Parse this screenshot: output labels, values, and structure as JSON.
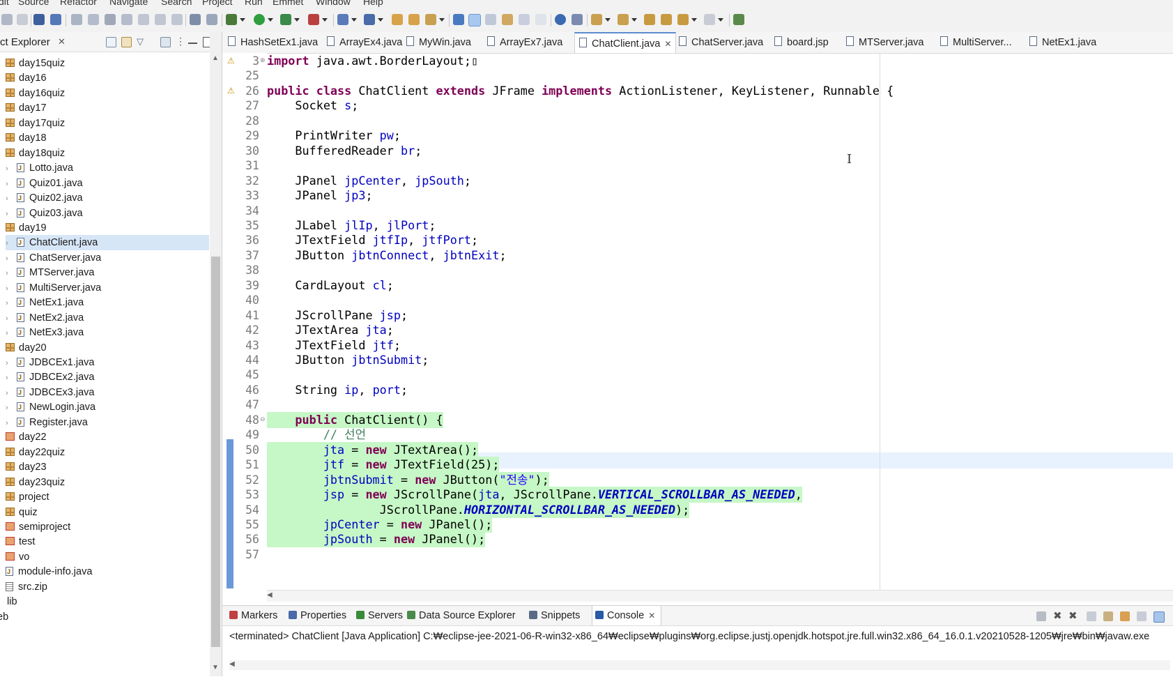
{
  "menu": [
    "dit",
    "Source",
    "Refactor",
    "Navigate",
    "Search",
    "Project",
    "Run",
    "Emmet",
    "Window",
    "Help"
  ],
  "explorer": {
    "title": "ct Explorer",
    "close_glyph": "✕",
    "tree": [
      {
        "label": "day15quiz",
        "kind": "package",
        "indent": 0
      },
      {
        "label": "day16",
        "kind": "package",
        "indent": 0
      },
      {
        "label": "day16quiz",
        "kind": "package",
        "indent": 0
      },
      {
        "label": "day17",
        "kind": "package",
        "indent": 0
      },
      {
        "label": "day17quiz",
        "kind": "package",
        "indent": 0
      },
      {
        "label": "day18",
        "kind": "package",
        "indent": 0
      },
      {
        "label": "day18quiz",
        "kind": "package",
        "indent": 0
      },
      {
        "label": "Lotto.java",
        "kind": "java",
        "indent": 1
      },
      {
        "label": "Quiz01.java",
        "kind": "java",
        "indent": 1
      },
      {
        "label": "Quiz02.java",
        "kind": "java",
        "indent": 1
      },
      {
        "label": "Quiz03.java",
        "kind": "java",
        "indent": 1
      },
      {
        "label": "day19",
        "kind": "package",
        "indent": 0
      },
      {
        "label": "ChatClient.java",
        "kind": "java",
        "indent": 1,
        "selected": true
      },
      {
        "label": "ChatServer.java",
        "kind": "java",
        "indent": 1
      },
      {
        "label": "MTServer.java",
        "kind": "java",
        "indent": 1
      },
      {
        "label": "MultiServer.java",
        "kind": "java",
        "indent": 1
      },
      {
        "label": "NetEx1.java",
        "kind": "java",
        "indent": 1
      },
      {
        "label": "NetEx2.java",
        "kind": "java",
        "indent": 1
      },
      {
        "label": "NetEx3.java",
        "kind": "java",
        "indent": 1
      },
      {
        "label": "day20",
        "kind": "package",
        "indent": 0
      },
      {
        "label": "JDBCEx1.java",
        "kind": "java",
        "indent": 1
      },
      {
        "label": "JDBCEx2.java",
        "kind": "java",
        "indent": 1
      },
      {
        "label": "JDBCEx3.java",
        "kind": "java",
        "indent": 1
      },
      {
        "label": "NewLogin.java",
        "kind": "java",
        "indent": 1
      },
      {
        "label": "Register.java",
        "kind": "java",
        "indent": 1
      },
      {
        "label": "day22",
        "kind": "package-error",
        "indent": 0
      },
      {
        "label": "day22quiz",
        "kind": "package",
        "indent": 0
      },
      {
        "label": "day23",
        "kind": "package",
        "indent": 0
      },
      {
        "label": "day23quiz",
        "kind": "package",
        "indent": 0
      },
      {
        "label": "project",
        "kind": "package",
        "indent": 0
      },
      {
        "label": "quiz",
        "kind": "package",
        "indent": 0
      },
      {
        "label": "semiproject",
        "kind": "package-error",
        "indent": 0
      },
      {
        "label": "test",
        "kind": "package-error",
        "indent": 0
      },
      {
        "label": "vo",
        "kind": "package-error",
        "indent": 0
      },
      {
        "label": "module-info.java",
        "kind": "java-plain",
        "indent": 0
      },
      {
        "label": "src.zip",
        "kind": "zip",
        "indent": 0
      },
      {
        "label": "lib",
        "kind": "folder-collapsed",
        "indent": -1
      },
      {
        "label": "eb",
        "kind": "folder-plain",
        "indent": -1
      }
    ]
  },
  "editor": {
    "tabs": [
      {
        "label": "HashSetEx1.java",
        "active": false
      },
      {
        "label": "ArrayEx4.java",
        "active": false
      },
      {
        "label": "MyWin.java",
        "active": false
      },
      {
        "label": "ArrayEx7.java",
        "active": false
      },
      {
        "label": "ChatClient.java",
        "active": true,
        "close": "✕"
      },
      {
        "label": "ChatServer.java",
        "active": false
      },
      {
        "label": "board.jsp",
        "active": false
      },
      {
        "label": "MTServer.java",
        "active": false
      },
      {
        "label": "MultiServer...",
        "active": false
      },
      {
        "label": "NetEx1.java",
        "active": false
      }
    ],
    "lines": [
      {
        "n": "3",
        "fold": "⊕",
        "warn": true,
        "tokens": [
          [
            "kw",
            "import"
          ],
          [
            "",
            " java.awt.BorderLayout;▯"
          ]
        ]
      },
      {
        "n": "25",
        "tokens": []
      },
      {
        "n": "26",
        "warn": true,
        "tokens": [
          [
            "kw",
            "public class"
          ],
          [
            "",
            " ChatClient "
          ],
          [
            "kw",
            "extends"
          ],
          [
            "",
            " JFrame "
          ],
          [
            "kw",
            "implements"
          ],
          [
            "",
            " ActionListener, KeyListener, Runnable {"
          ]
        ]
      },
      {
        "n": "27",
        "tokens": [
          [
            "",
            "    Socket "
          ],
          [
            "fld",
            "s"
          ],
          [
            "",
            ";"
          ]
        ]
      },
      {
        "n": "28",
        "tokens": []
      },
      {
        "n": "29",
        "tokens": [
          [
            "",
            "    PrintWriter "
          ],
          [
            "fld",
            "pw"
          ],
          [
            "",
            ";"
          ]
        ]
      },
      {
        "n": "30",
        "tokens": [
          [
            "",
            "    BufferedReader "
          ],
          [
            "fld",
            "br"
          ],
          [
            "",
            ";"
          ]
        ]
      },
      {
        "n": "31",
        "tokens": []
      },
      {
        "n": "32",
        "tokens": [
          [
            "",
            "    JPanel "
          ],
          [
            "fld",
            "jpCenter"
          ],
          [
            "",
            ", "
          ],
          [
            "fld",
            "jpSouth"
          ],
          [
            "",
            ";"
          ]
        ]
      },
      {
        "n": "33",
        "tokens": [
          [
            "",
            "    JPanel "
          ],
          [
            "fld",
            "jp3"
          ],
          [
            "",
            ";"
          ]
        ]
      },
      {
        "n": "34",
        "tokens": []
      },
      {
        "n": "35",
        "tokens": [
          [
            "",
            "    JLabel "
          ],
          [
            "fld",
            "jlIp"
          ],
          [
            "",
            ", "
          ],
          [
            "fld",
            "jlPort"
          ],
          [
            "",
            ";"
          ]
        ]
      },
      {
        "n": "36",
        "tokens": [
          [
            "",
            "    JTextField "
          ],
          [
            "fld",
            "jtfIp"
          ],
          [
            "",
            ", "
          ],
          [
            "fld",
            "jtfPort"
          ],
          [
            "",
            ";"
          ]
        ]
      },
      {
        "n": "37",
        "tokens": [
          [
            "",
            "    JButton "
          ],
          [
            "fld",
            "jbtnConnect"
          ],
          [
            "",
            ", "
          ],
          [
            "fld",
            "jbtnExit"
          ],
          [
            "",
            ";"
          ]
        ]
      },
      {
        "n": "38",
        "tokens": []
      },
      {
        "n": "39",
        "tokens": [
          [
            "",
            "    CardLayout "
          ],
          [
            "fld",
            "cl"
          ],
          [
            "",
            ";"
          ]
        ]
      },
      {
        "n": "40",
        "tokens": []
      },
      {
        "n": "41",
        "tokens": [
          [
            "",
            "    JScrollPane "
          ],
          [
            "fld",
            "jsp"
          ],
          [
            "",
            ";"
          ]
        ]
      },
      {
        "n": "42",
        "tokens": [
          [
            "",
            "    JTextArea "
          ],
          [
            "fld",
            "jta"
          ],
          [
            "",
            ";"
          ]
        ]
      },
      {
        "n": "43",
        "tokens": [
          [
            "",
            "    JTextField "
          ],
          [
            "fld",
            "jtf"
          ],
          [
            "",
            ";"
          ]
        ]
      },
      {
        "n": "44",
        "tokens": [
          [
            "",
            "    JButton "
          ],
          [
            "fld",
            "jbtnSubmit"
          ],
          [
            "",
            ";"
          ]
        ]
      },
      {
        "n": "45",
        "tokens": []
      },
      {
        "n": "46",
        "tokens": [
          [
            "",
            "    String "
          ],
          [
            "fld",
            "ip"
          ],
          [
            "",
            ", "
          ],
          [
            "fld",
            "port"
          ],
          [
            "",
            ";"
          ]
        ]
      },
      {
        "n": "47",
        "tokens": []
      },
      {
        "n": "48",
        "fold": "⊖",
        "hl": true,
        "tokens": [
          [
            "",
            "    "
          ],
          [
            "kw",
            "public"
          ],
          [
            "",
            " ChatClient() {"
          ]
        ]
      },
      {
        "n": "49",
        "current": true,
        "tokens": [
          [
            "",
            "        "
          ],
          [
            "cmt",
            "// 선언"
          ]
        ]
      },
      {
        "n": "50",
        "hl": true,
        "tokens": [
          [
            "",
            "        "
          ],
          [
            "fld",
            "jta"
          ],
          [
            "",
            " = "
          ],
          [
            "kw",
            "new"
          ],
          [
            "",
            " JTextArea();"
          ]
        ]
      },
      {
        "n": "51",
        "hl": true,
        "tokens": [
          [
            "",
            "        "
          ],
          [
            "fld",
            "jtf"
          ],
          [
            "",
            " = "
          ],
          [
            "kw",
            "new"
          ],
          [
            "",
            " JTextField(25);"
          ]
        ]
      },
      {
        "n": "52",
        "hl": true,
        "tokens": [
          [
            "",
            "        "
          ],
          [
            "fld",
            "jbtnSubmit"
          ],
          [
            "",
            " = "
          ],
          [
            "kw",
            "new"
          ],
          [
            "",
            " JButton("
          ],
          [
            "str",
            "\"전송\""
          ],
          [
            "",
            ");"
          ]
        ]
      },
      {
        "n": "53",
        "hl": true,
        "tokens": [
          [
            "",
            "        "
          ],
          [
            "fld",
            "jsp"
          ],
          [
            "",
            " = "
          ],
          [
            "kw",
            "new"
          ],
          [
            "",
            " JScrollPane("
          ],
          [
            "fld",
            "jta"
          ],
          [
            "",
            ", JScrollPane."
          ],
          [
            "sfld",
            "VERTICAL_SCROLLBAR_AS_NEEDED"
          ],
          [
            "",
            ","
          ]
        ]
      },
      {
        "n": "54",
        "hl": true,
        "tokens": [
          [
            "",
            "                JScrollPane."
          ],
          [
            "sfld",
            "HORIZONTAL_SCROLLBAR_AS_NEEDED"
          ],
          [
            "",
            ");"
          ]
        ]
      },
      {
        "n": "55",
        "hl": true,
        "tokens": [
          [
            "",
            "        "
          ],
          [
            "fld",
            "jpCenter"
          ],
          [
            "",
            " = "
          ],
          [
            "kw",
            "new"
          ],
          [
            "",
            " JPanel();"
          ]
        ]
      },
      {
        "n": "56",
        "hl": true,
        "tokens": [
          [
            "",
            "        "
          ],
          [
            "fld",
            "jpSouth"
          ],
          [
            "",
            " = "
          ],
          [
            "kw",
            "new"
          ],
          [
            "",
            " JPanel();"
          ]
        ]
      },
      {
        "n": "57",
        "tokens": []
      }
    ]
  },
  "console": {
    "tabs": [
      "Markers",
      "Properties",
      "Servers",
      "Data Source Explorer",
      "Snippets",
      "Console"
    ],
    "active_tab": "Console",
    "close_glyph": "✕",
    "status_line": "<terminated> ChatClient [Java Application] C:₩eclipse-jee-2021-06-R-win32-x86_64₩eclipse₩plugins₩org.eclipse.justj.openjdk.hotspot.jre.full.win32.x86_64_16.0.1.v20210528-1205₩jre₩bin₩javaw.exe"
  },
  "colors": {
    "keyword": "#7f0055",
    "field": "#0000c0",
    "string": "#2a00ff",
    "comment": "#3f7f5f",
    "change_highlight": "#c6f7c6",
    "current_line": "#e8f2fe",
    "tab_accent": "#5b8bd0"
  }
}
